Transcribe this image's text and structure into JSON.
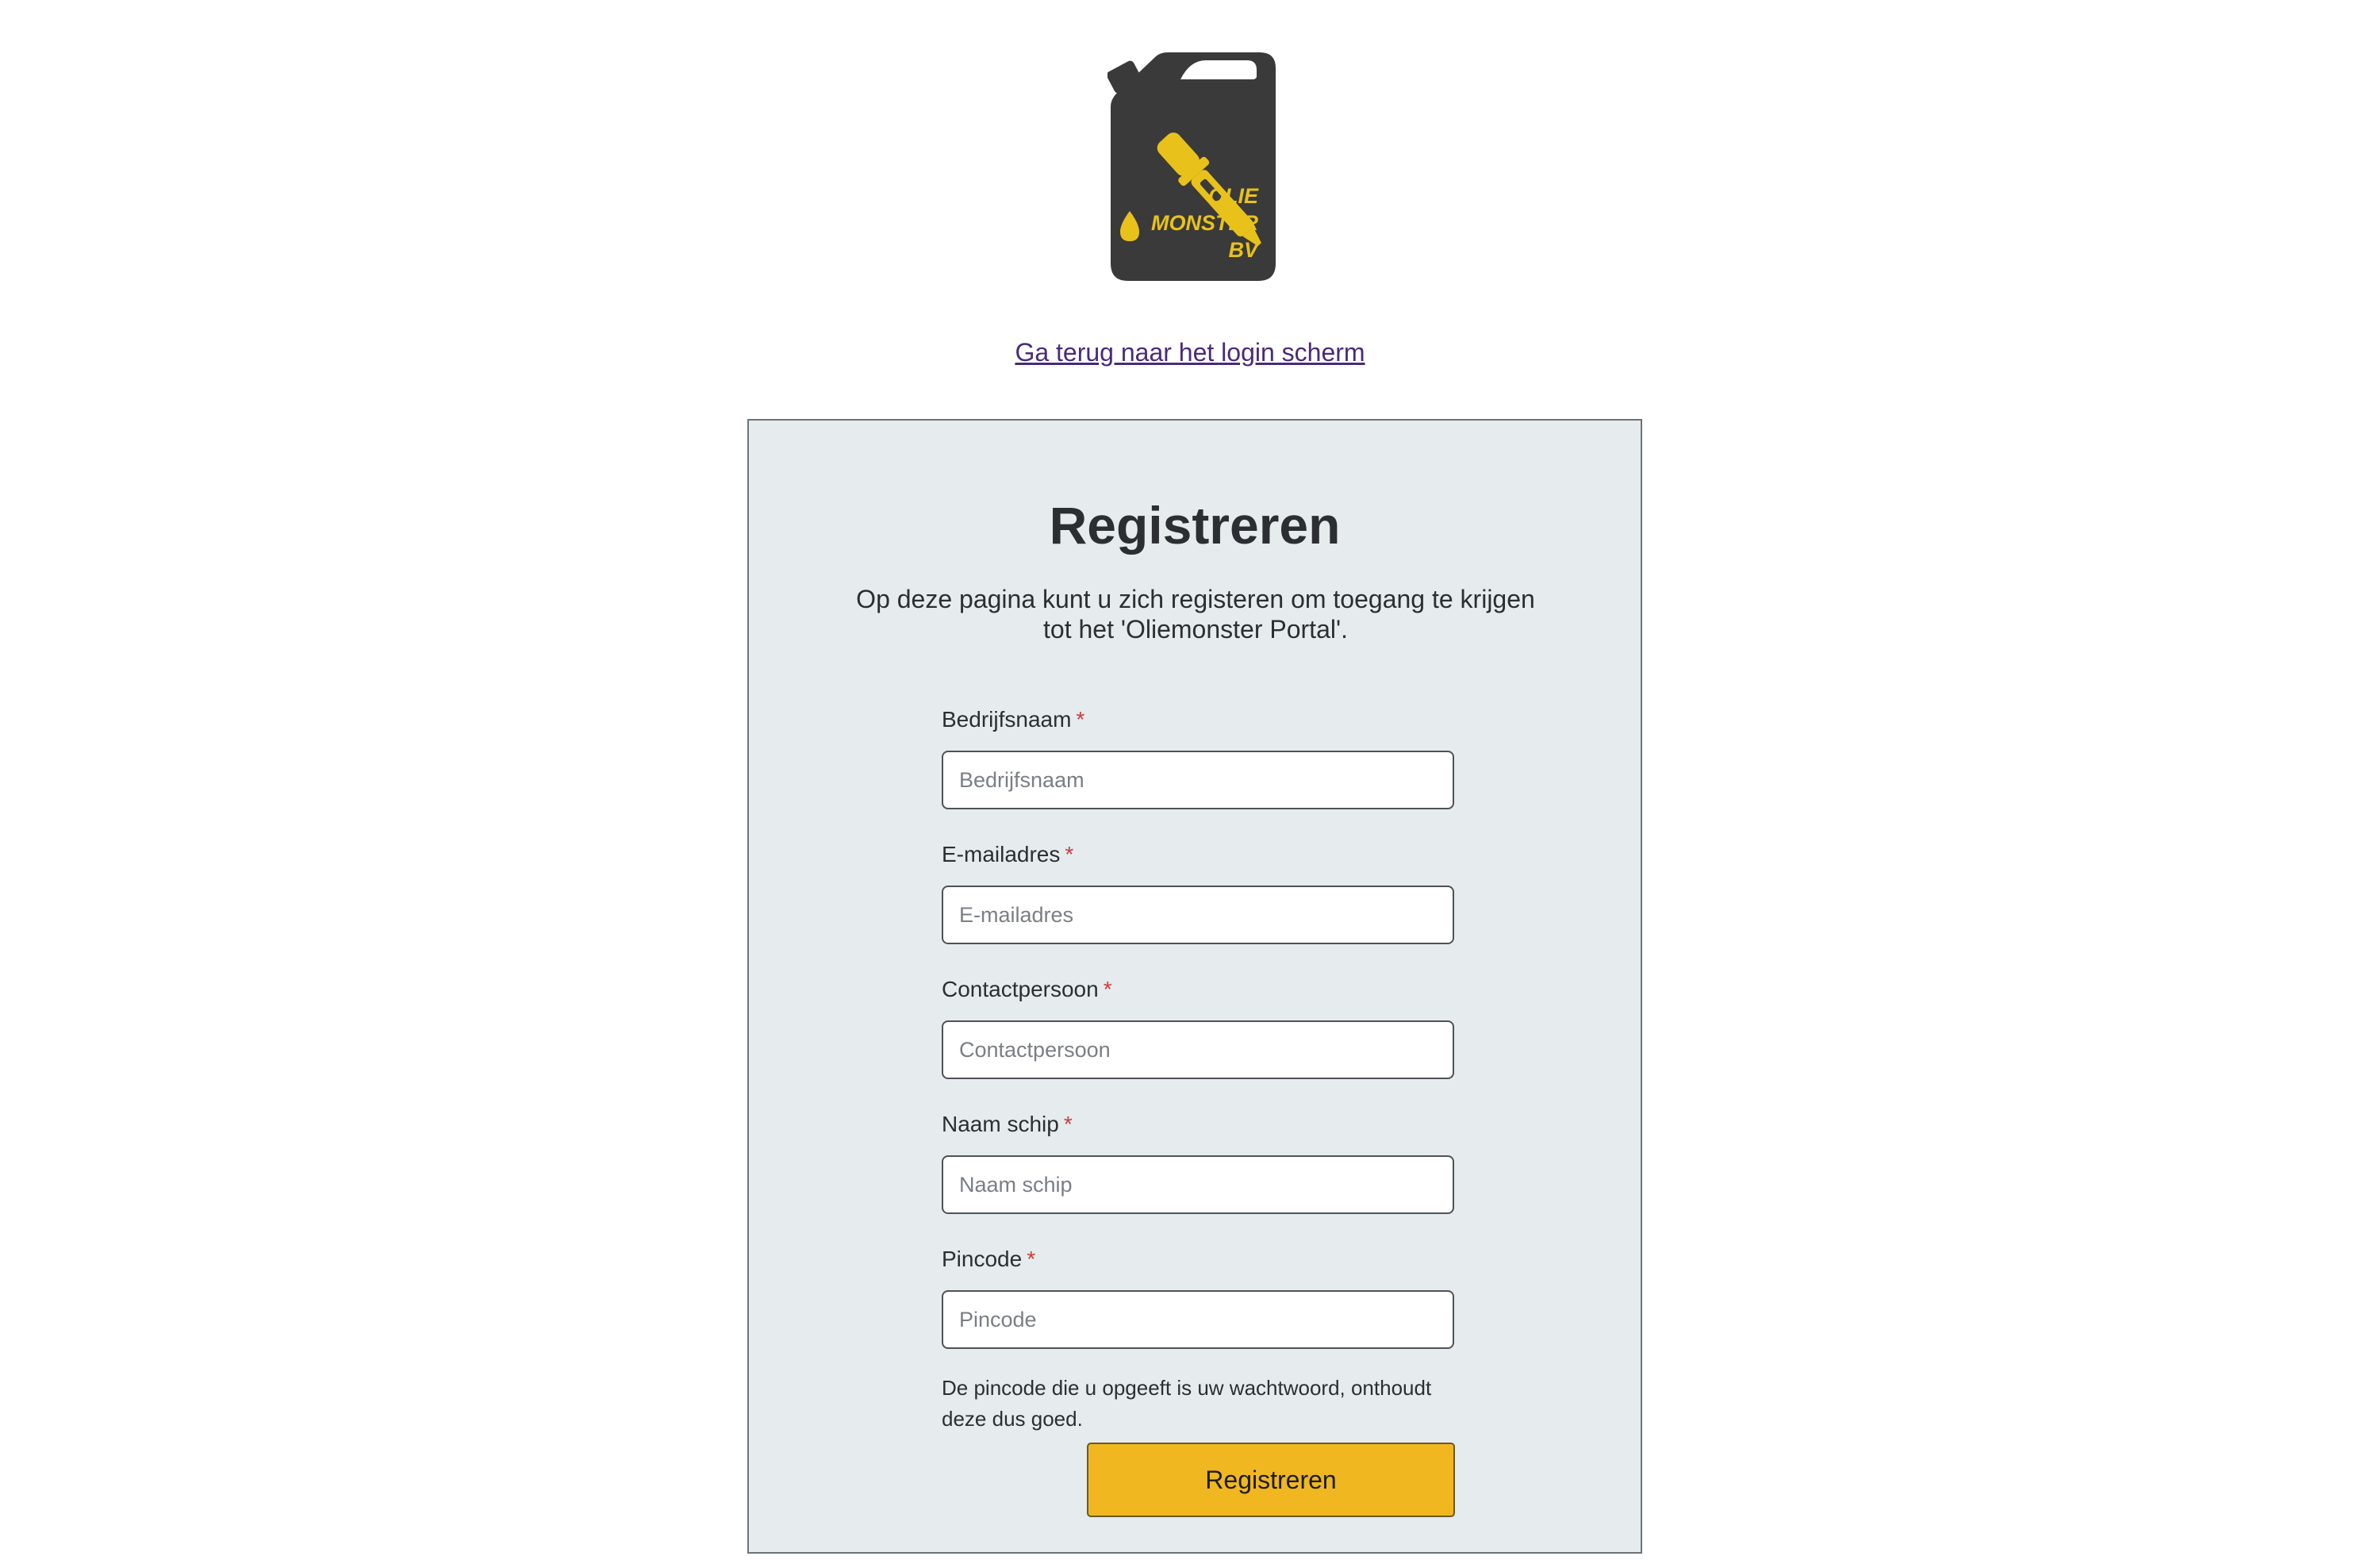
{
  "logo": {
    "alt_lines": [
      "OLIE",
      "MONSTER",
      "BV"
    ],
    "body_color": "#3a3a3a",
    "accent_color": "#e8c21a"
  },
  "back_link": {
    "label": "Ga terug naar het login scherm"
  },
  "form": {
    "title": "Registreren",
    "intro": "Op deze pagina kunt u zich registeren om toegang te krijgen tot het 'Oliemonster Portal'.",
    "required_marker": "*",
    "fields": [
      {
        "label": "Bedrijfsnaam",
        "placeholder": "Bedrijfsnaam",
        "value": ""
      },
      {
        "label": "E-mailadres",
        "placeholder": "E-mailadres",
        "value": ""
      },
      {
        "label": "Contactpersoon",
        "placeholder": "Contactpersoon",
        "value": ""
      },
      {
        "label": "Naam schip",
        "placeholder": "Naam schip",
        "value": ""
      },
      {
        "label": "Pincode",
        "placeholder": "Pincode",
        "value": ""
      }
    ],
    "pin_hint": "De pincode die u opgeeft is uw wachtwoord, onthoudt deze dus goed.",
    "submit_label": "Registreren"
  },
  "colors": {
    "card_background": "#e6ebed",
    "button_background": "#f0b720",
    "required_color": "#d03a3a",
    "link_color": "#4a2a7a"
  }
}
